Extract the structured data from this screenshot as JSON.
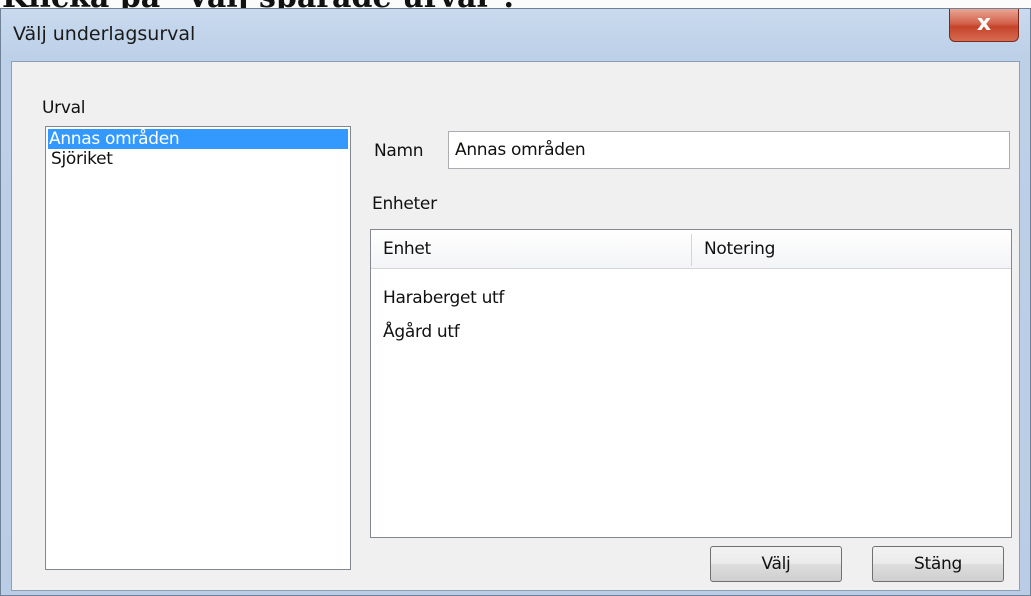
{
  "background": {
    "doc_text": "Klicka på \"Välj sparade urval\"."
  },
  "window": {
    "title": "Välj underlagsurval",
    "close_glyph": "x"
  },
  "urval": {
    "label": "Urval",
    "items": [
      "Annas områden",
      "Sjöriket"
    ],
    "selected_index": 0
  },
  "namn": {
    "label": "Namn",
    "value": "Annas områden"
  },
  "enheter": {
    "label": "Enheter",
    "columns": [
      "Enhet",
      "Notering"
    ],
    "rows": [
      {
        "enhet": "Haraberget utf",
        "notering": ""
      },
      {
        "enhet": "Ågård utf",
        "notering": ""
      }
    ]
  },
  "buttons": {
    "valj": "Välj",
    "stang": "Stäng"
  },
  "colors": {
    "selection": "#3399ff",
    "close_button": "#c5432b",
    "window_frame": "#bcd0e8"
  }
}
